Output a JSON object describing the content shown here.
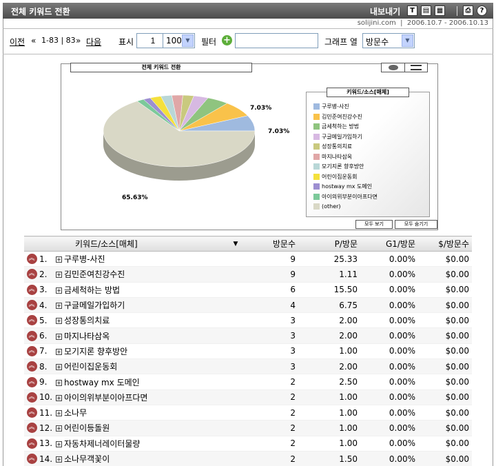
{
  "titlebar": {
    "title": "전체 키워드 전환",
    "export_label": "내보내기"
  },
  "subbar": {
    "site": "solijini.com",
    "date_range": "2006.10.7 - 2006.10.13"
  },
  "pager": {
    "prev": "이전",
    "prev_arrows": "«",
    "range": "1-83",
    "total": "83",
    "next_arrows": "»",
    "next": "다음"
  },
  "show": {
    "label": "표시",
    "start": "1",
    "count": "100"
  },
  "filter": {
    "label": "필터",
    "value": ""
  },
  "graph": {
    "label": "그래프 열",
    "selected": "방문수"
  },
  "chart": {
    "title": "전체 키워드 전환",
    "legend_title": "키워드/소스[매체]",
    "show_all": "모두 보기",
    "hide_all": "모두 숨기기"
  },
  "chart_data": {
    "type": "pie",
    "title": "전체 키워드 전환",
    "slices": [
      {
        "label": "구루병-사진",
        "value": 7.03,
        "color": "#9fbadf"
      },
      {
        "label": "김민준여친강수진",
        "value": 7.03,
        "color": "#f9c24a"
      },
      {
        "label": "금세척하는 방법",
        "value": 4.69,
        "color": "#8fc47f"
      },
      {
        "label": "구글메일가입하기",
        "value": 3.13,
        "color": "#d7b9e2"
      },
      {
        "label": "성장통의치료",
        "value": 2.34,
        "color": "#c9c97e"
      },
      {
        "label": "마지나타삼옥",
        "value": 2.34,
        "color": "#e0a7a7"
      },
      {
        "label": "모기지론 향후방안",
        "value": 2.34,
        "color": "#b9d7d7"
      },
      {
        "label": "어린이집운동회",
        "value": 2.34,
        "color": "#f4e03c"
      },
      {
        "label": "hostway mx 도메인",
        "value": 1.56,
        "color": "#9d8fd1"
      },
      {
        "label": "아이의위부분이아프다면",
        "value": 1.56,
        "color": "#7cc99a"
      },
      {
        "label": "(other)",
        "value": 65.63,
        "color": "#d9d8c6"
      }
    ],
    "data_labels": [
      "7.03%",
      "7.03%",
      "65.63%"
    ]
  },
  "table": {
    "headers": {
      "keyword": "키워드/소스[매체]",
      "visits": "방문수",
      "pv": "P/방문",
      "g1": "G1/방문",
      "dollar": "$/방문수"
    },
    "rows": [
      {
        "no": "1.",
        "name": "구루병-사진",
        "visits": "9",
        "pv": "25.33",
        "g1": "0.00%",
        "dollar": "$0.00"
      },
      {
        "no": "2.",
        "name": "김민준여친강수진",
        "visits": "9",
        "pv": "1.11",
        "g1": "0.00%",
        "dollar": "$0.00"
      },
      {
        "no": "3.",
        "name": "금세척하는 방법",
        "visits": "6",
        "pv": "15.50",
        "g1": "0.00%",
        "dollar": "$0.00"
      },
      {
        "no": "4.",
        "name": "구글메일가입하기",
        "visits": "4",
        "pv": "6.75",
        "g1": "0.00%",
        "dollar": "$0.00"
      },
      {
        "no": "5.",
        "name": "성장통의치료",
        "visits": "3",
        "pv": "2.00",
        "g1": "0.00%",
        "dollar": "$0.00"
      },
      {
        "no": "6.",
        "name": "마지나타삼옥",
        "visits": "3",
        "pv": "2.00",
        "g1": "0.00%",
        "dollar": "$0.00"
      },
      {
        "no": "7.",
        "name": "모기지론 향후방안",
        "visits": "3",
        "pv": "1.00",
        "g1": "0.00%",
        "dollar": "$0.00"
      },
      {
        "no": "8.",
        "name": "어린이집운동회",
        "visits": "3",
        "pv": "2.00",
        "g1": "0.00%",
        "dollar": "$0.00"
      },
      {
        "no": "9.",
        "name": "hostway mx 도메인",
        "visits": "2",
        "pv": "2.50",
        "g1": "0.00%",
        "dollar": "$0.00"
      },
      {
        "no": "10.",
        "name": "아이의위부분이아프다면",
        "visits": "2",
        "pv": "1.00",
        "g1": "0.00%",
        "dollar": "$0.00"
      },
      {
        "no": "11.",
        "name": "소나무",
        "visits": "2",
        "pv": "1.00",
        "g1": "0.00%",
        "dollar": "$0.00"
      },
      {
        "no": "12.",
        "name": "어린이등돌원",
        "visits": "2",
        "pv": "1.00",
        "g1": "0.00%",
        "dollar": "$0.00"
      },
      {
        "no": "13.",
        "name": "자동차제너레이터물량",
        "visits": "2",
        "pv": "1.00",
        "g1": "0.00%",
        "dollar": "$0.00"
      },
      {
        "no": "14.",
        "name": "소나무객꽃이",
        "visits": "2",
        "pv": "1.50",
        "g1": "0.00%",
        "dollar": "$0.00"
      }
    ]
  }
}
